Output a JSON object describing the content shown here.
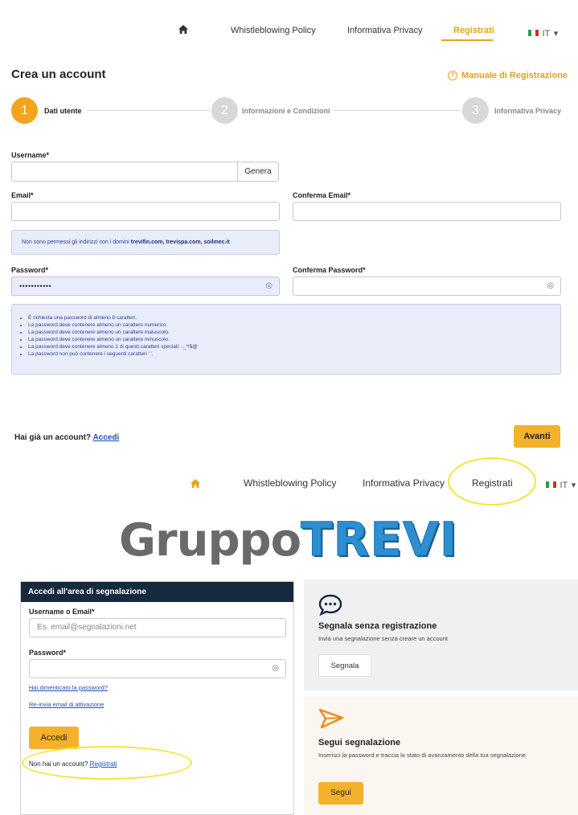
{
  "register": {
    "nav": {
      "items": [
        "Whistleblowing Policy",
        "Informativa Privacy",
        "Registrati"
      ],
      "lang": "IT"
    },
    "title": "Crea un account",
    "manual_link": "Manuale di Registrazione",
    "steps": [
      {
        "num": "1",
        "label": "Dati utente"
      },
      {
        "num": "2",
        "label": "Informazioni e Condizioni"
      },
      {
        "num": "3",
        "label": "Informativa Privacy"
      }
    ],
    "fields": {
      "username_label": "Username*",
      "genera_button": "Genera",
      "email_label": "Email*",
      "confirm_email_label": "Conferma Email*",
      "password_label": "Password*",
      "password_value": "•••••••••••",
      "confirm_password_label": "Conferma Password*"
    },
    "domain_notice": {
      "text": "Non sono permessi gli indirizzi con i domini",
      "domains": "trevifin.com, trevispa.com, soilmec.it"
    },
    "password_rules": [
      "È richiesta una password di almeno 8 caratteri.",
      "La password deve contenere almeno un carattere numerico.",
      "La password deve contenere almeno un carattere maiuscolo.",
      "La password deve contenere almeno un carattere minuscolo.",
      "La password deve contenere almeno 1 di questi caratteri speciali: -_*!$@",
      "La password non può contenere i seguenti caratteri ' '."
    ],
    "have_account": "Hai già un account?",
    "login_link": "Accedi",
    "next_button": "Avanti"
  },
  "home": {
    "nav": {
      "items": [
        "Whistleblowing Policy",
        "Informativa Privacy",
        "Registrati"
      ],
      "lang": "IT"
    },
    "logo": {
      "part1": "Gruppo",
      "part2": "TREVI"
    },
    "login": {
      "header": "Accedi all'area di segnalazione",
      "username_label": "Username o Email*",
      "username_placeholder": "Es. email@segnalazioni.net",
      "password_label": "Password*",
      "forgot_link": "Hai dimenticato la password?",
      "resend_link": "Re-invia email di attivazione",
      "login_button": "Accedi",
      "no_account": "Non hai un account?",
      "register_link": "Registrati"
    },
    "report_panel": {
      "title": "Segnala senza registrazione",
      "subtitle": "Invia una segnalazione senza creare un account",
      "button": "Segnala"
    },
    "follow_panel": {
      "title": "Segui segnalazione",
      "subtitle": "Inserisci la password e traccia lo stato di avanzamento della tua segnalazione",
      "button": "Segui"
    }
  },
  "colors": {
    "accent": "#f4a31c",
    "header_dark": "#172a3d",
    "highlight_ellipse": "#f2e63c",
    "link": "#1d4fb5"
  }
}
